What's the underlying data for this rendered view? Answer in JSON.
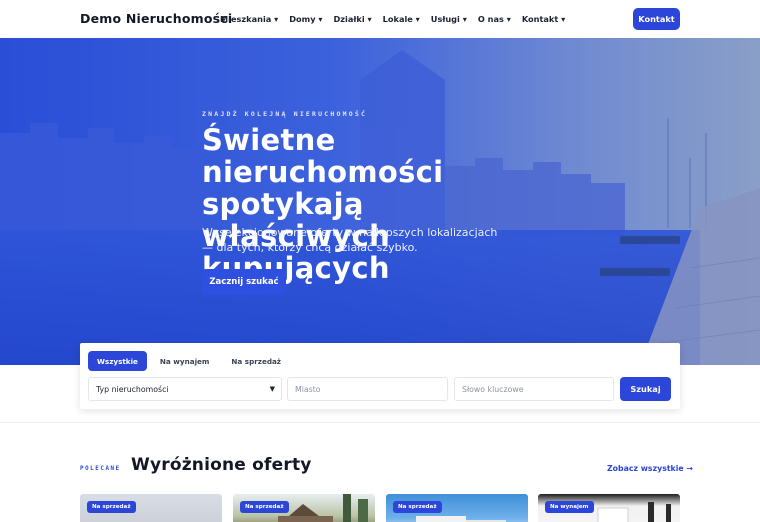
{
  "header": {
    "logo": "Demo Nieruchomości",
    "nav": [
      "Mieszkania ▾",
      "Domy ▾",
      "Działki ▾",
      "Lokale ▾",
      "Usługi ▾",
      "O nas ▾",
      "Kontakt ▾"
    ],
    "contact_button": "Kontakt",
    "accent_color": "#2b46d8"
  },
  "hero": {
    "eyebrow": "ZNAJDŹ KOLEJNĄ NIERUCHOMOŚĆ",
    "title": "Świetne nieruchomości spotykają właściwych kupujących",
    "subtitle": "Wyselekcjonowane oferty w najlepszych lokalizacjach — dla tych, którzy chcą działać szybko.",
    "cta": "Zacznij szukać"
  },
  "search": {
    "tabs": [
      "Wszystkie",
      "Na wynajem",
      "Na sprzedaż"
    ],
    "active_tab": "Wszystkie",
    "type_select": "Typ nieruchomości",
    "city_placeholder": "Miasto",
    "keyword_placeholder": "Słowo kluczowe",
    "submit": "Szukaj"
  },
  "featured": {
    "eyebrow": "POLECANE",
    "title": "Wyróżnione oferty",
    "see_all": "Zobacz wszystkie →",
    "cards": [
      {
        "badge": "Na sprzedaż"
      },
      {
        "badge": "Na sprzedaż"
      },
      {
        "badge": "Na sprzedaż"
      },
      {
        "badge": "Na wynajem"
      }
    ]
  }
}
